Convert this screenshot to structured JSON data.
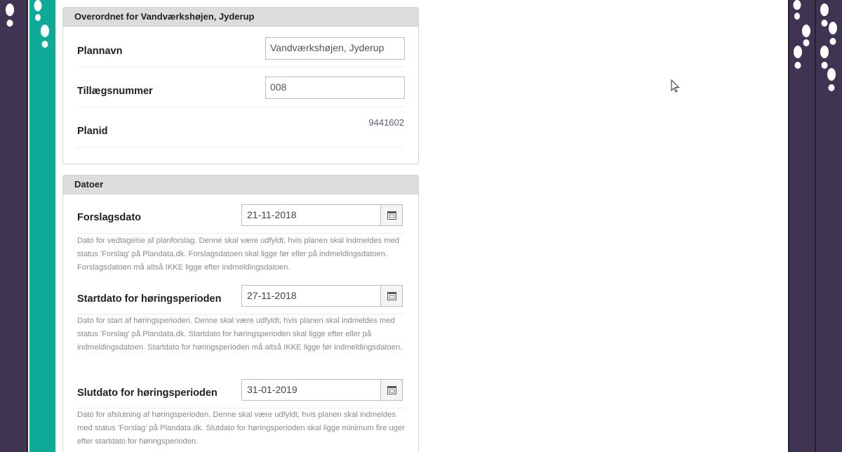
{
  "panel_overordnet": {
    "title": "Overordnet for Vandværkshøjen, Jyderup",
    "plannavn_label": "Plannavn",
    "plannavn_value": "Vandværkshøjen, Jyderup",
    "tillaeg_label": "Tillægsnummer",
    "tillaeg_value": "008",
    "planid_label": "Planid",
    "planid_value": "9441602"
  },
  "panel_datoer": {
    "title": "Datoer",
    "forslag_label": "Forslagsdato",
    "forslag_value": "21-11-2018",
    "forslag_help": "Dato for vedtagelse af planforslag. Denne skal være udfyldt, hvis planen skal indmeldes med status 'Forslag' på Plandata.dk. Forslagsdatoen skal ligge før eller på indmeldingsdatoen. Forslagsdatoen må altså IKKE ligge efter indmeldingsdatoen.",
    "start_label": "Startdato for høringsperioden",
    "start_value": "27-11-2018",
    "start_help": "Dato for start af høringsperioden. Denne skal være udfyldt, hvis planen skal indmeldes med status 'Forslag' på Plandata.dk. Startdato for høringsperioden skal ligge efter eller på indmeldingsdatoen. Startdato for høringsperioden må altså IKKE ligge før indmeldingsdatoen.",
    "slut_label": "Slutdato for høringsperioden",
    "slut_value": "31-01-2019",
    "slut_help": "Dato for afslutning af høringsperioden. Denne skal være udfyldt, hvis planen skal indmeldes med status 'Forslag' på Plandata.dk. Slutdato for høringsperioden skal ligge minimum fire uger efter startdato for høringsperioden."
  },
  "icons": {
    "calendar": "calendar-icon",
    "footprint": "footprint-icon",
    "cursor": "mouse-pointer-icon"
  },
  "colors": {
    "purple": "#3f3452",
    "teal": "#0daa97",
    "header_bg": "#dcdcdc",
    "planid_text": "#5c5c7a"
  }
}
